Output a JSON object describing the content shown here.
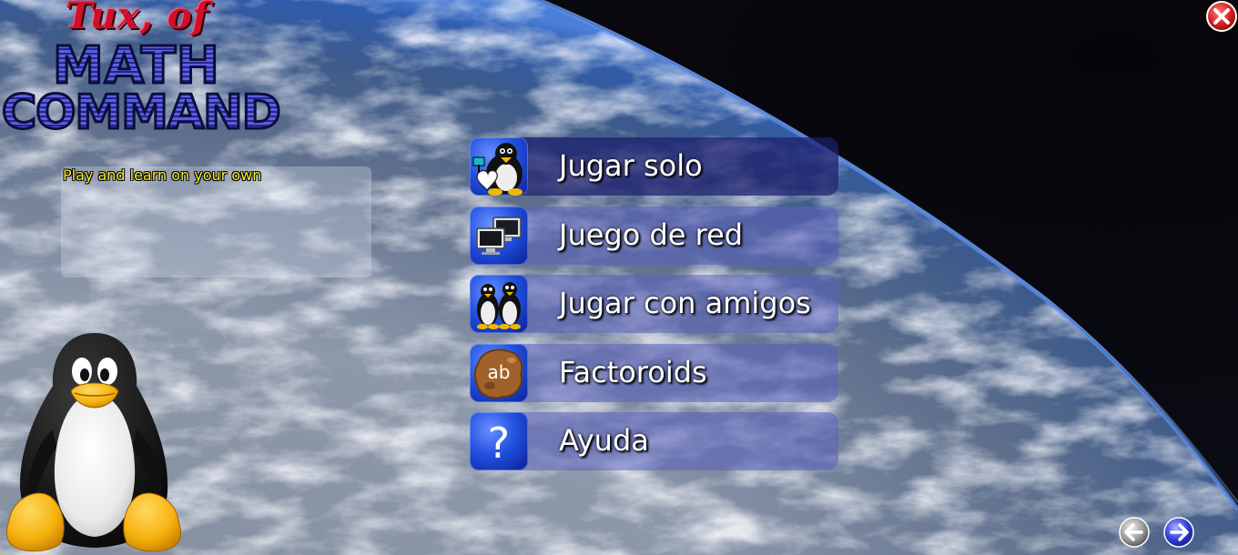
{
  "logo": {
    "line1": "Tux, of",
    "line2": "MATH",
    "line3": "COMMAND"
  },
  "description": "Play and learn on your own",
  "menu": [
    {
      "label": "Jugar solo",
      "icon": "tux-with-heart-icon",
      "selected": true
    },
    {
      "label": "Juego de red",
      "icon": "network-computers-icon",
      "selected": false
    },
    {
      "label": "Jugar con amigos",
      "icon": "two-penguins-icon",
      "selected": false
    },
    {
      "label": "Factoroids",
      "icon": "asteroid-ab-icon",
      "selected": false
    },
    {
      "label": "Ayuda",
      "icon": "question-mark-icon",
      "selected": false
    }
  ],
  "help_icon_glyph": "?",
  "factoroids_icon_text": "ab",
  "buttons": {
    "close": "close-icon",
    "prev": "arrow-left-icon",
    "next": "arrow-right-icon"
  },
  "colors": {
    "menu_bar": "#5a60be",
    "menu_bar_selected": "#1c1e6e",
    "description_text": "#f4ee2a",
    "logo_red": "#d0102a",
    "logo_blue": "#3b3fb8",
    "close_red": "#d42020",
    "nav_blue": "#2d3bd8"
  }
}
